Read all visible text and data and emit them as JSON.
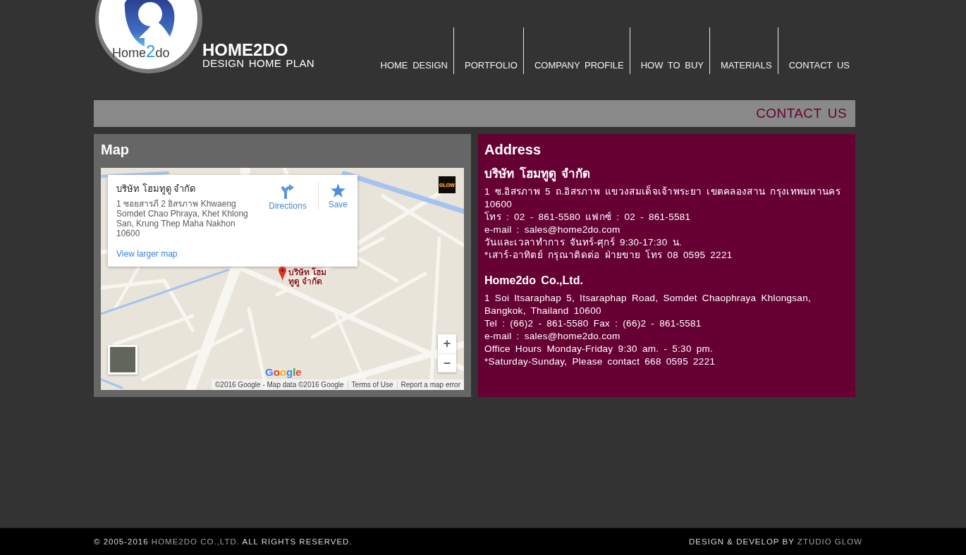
{
  "header": {
    "logo": {
      "parts": [
        {
          "text": "Home",
          "kind": "plain"
        },
        {
          "text": "2",
          "kind": "accent"
        },
        {
          "text": "do",
          "kind": "plain"
        }
      ]
    },
    "brand": {
      "name": "HOME2DO",
      "tagline": "DESIGN HOME PLAN"
    }
  },
  "nav": [
    {
      "label": "HOME DESIGN"
    },
    {
      "label": "PORTFOLIO"
    },
    {
      "label": "COMPANY PROFILE"
    },
    {
      "label": "HOW TO BUY"
    },
    {
      "label": "MATERIALS"
    },
    {
      "label": "CONTACT US"
    }
  ],
  "page_title": "CONTACT US",
  "map_panel": {
    "title": "Map",
    "info_card": {
      "name": "บริษัท โฮมทูดู จำกัด",
      "address": "1 ซอยสารภี 2 อิสรภาพ Khwaeng Somdet Chao Phraya, Khet Khlong San, Krung Thep Maha Nakhon 10600",
      "actions": [
        {
          "label": "Directions",
          "kind": "directions"
        },
        {
          "label": "Save",
          "kind": "save"
        }
      ],
      "link": "View larger map"
    },
    "marker_label": [
      "บริษัท โฮม",
      "ทูดู จำกัด"
    ],
    "layer_badge": "GLOW",
    "zoom_controls": [
      "+",
      "−"
    ],
    "logo": "Google",
    "attribution": "©2016 Google - Map data ©2016 Google",
    "links": [
      "Terms of Use",
      "Report a map error"
    ]
  },
  "address_panel": {
    "title": "Address",
    "sections": [
      {
        "heading": "บริษัท โฮมทูดู จำกัด",
        "lines": [
          "1 ซ.อิสรภาพ 5 ถ.อิสรภาพ แขวงสมเด็จเจ้าพระยา เขตคลองสาน กรุงเทพมหานคร 10600",
          "โทร : 02 - 861-5580 แฟกซ์ : 02 - 861-5581",
          "e-mail : sales@home2do.com",
          "วันและเวลาทำการ จันทร์-ศุกร์ 9:30-17:30 น.",
          "*เสาร์-อาทิตย์ กรุณาติดต่อ ฝ่ายขาย โทร 08 0595 2221"
        ]
      },
      {
        "heading": "Home2do Co.,Ltd.",
        "lines": [
          "1 Soi Itsaraphap 5, Itsaraphap Road, Somdet Chaophraya Khlongsan, Bangkok, Thailand 10600",
          "Tel : (66)2 - 861-5580 Fax : (66)2 - 861-5581",
          "e-mail : sales@home2do.com",
          "Office Hours Monday-Friday 9:30 am. - 5:30 pm.",
          "*Saturday-Sunday, Please contact 668 0595 2221"
        ]
      }
    ]
  },
  "footer": {
    "copyright": {
      "prefix": "© 2005-2016",
      "link": "HOME2DO CO.,LTD.",
      "suffix": "ALL RIGHTS RESERVED."
    },
    "credit": {
      "prefix": "DESIGN & DEVELOP BY",
      "link": "ZTUDIO GLOW"
    }
  }
}
